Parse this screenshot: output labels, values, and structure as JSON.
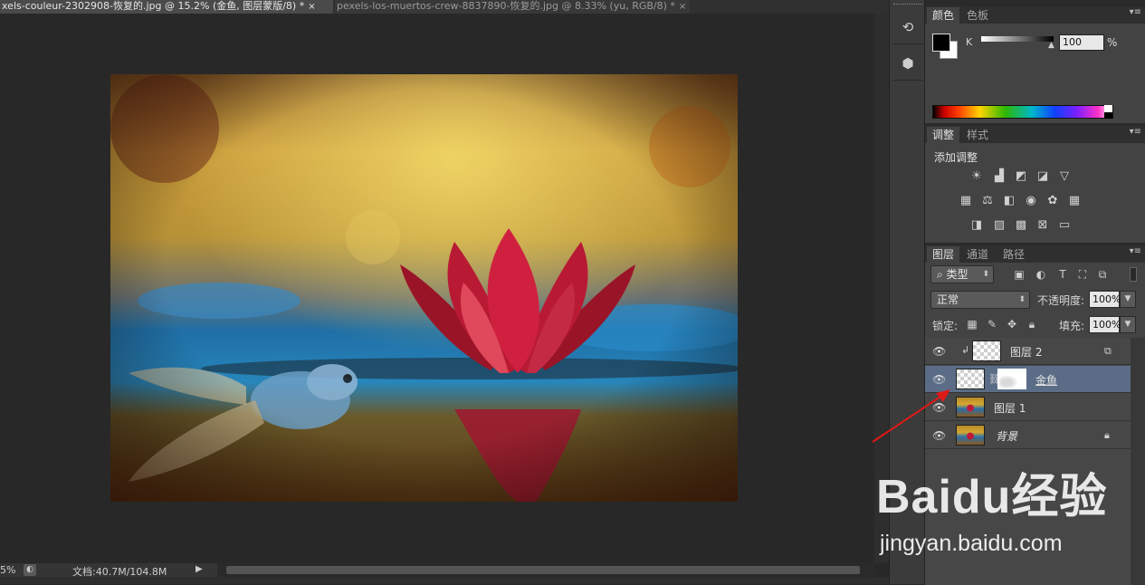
{
  "document_tabs": [
    {
      "label": "xels-couleur-2302908-恢复的.jpg @ 15.2% (金鱼, 图层蒙版/8) *",
      "active": true
    },
    {
      "label": "pexels-los-muertos-crew-8837890-恢复的.jpg @ 8.33% (yu, RGB/8) *",
      "active": false
    }
  ],
  "tab_close": "×",
  "status": {
    "zoom": "5%",
    "doc_info": "文档:40.7M/104.8M"
  },
  "color_panel": {
    "tabs": [
      "颜色",
      "色板"
    ],
    "channel": "K",
    "value": "100",
    "unit": "%"
  },
  "adjustments_panel": {
    "tabs": [
      "调整",
      "样式"
    ],
    "title": "添加调整",
    "icons": [
      "brightness-icon",
      "levels-icon",
      "curves-icon",
      "exposure-icon",
      "vibrance-icon",
      "hue-saturation-icon",
      "color-balance-icon",
      "black-white-icon",
      "photo-filter-icon",
      "channel-mixer-icon",
      "color-lookup-icon",
      "invert-icon",
      "posterize-icon",
      "threshold-icon",
      "selective-color-icon",
      "gradient-map-icon"
    ]
  },
  "layers_panel": {
    "tabs": [
      "图层",
      "通道",
      "路径"
    ],
    "filter_kind": "类型",
    "blend_mode": "正常",
    "opacity_label": "不透明度:",
    "opacity_value": "100%",
    "lock_label": "锁定:",
    "fill_label": "填充:",
    "fill_value": "100%",
    "layers": [
      {
        "name": "图层 2",
        "clipped": true,
        "selected": false
      },
      {
        "name": "金鱼",
        "has_mask": true,
        "selected": true
      },
      {
        "name": "图层 1",
        "selected": false
      },
      {
        "name": "背景",
        "locked": true,
        "selected": false
      }
    ]
  },
  "watermark": {
    "logo_text": "Baidu经验",
    "url": "jingyan.baidu.com"
  }
}
